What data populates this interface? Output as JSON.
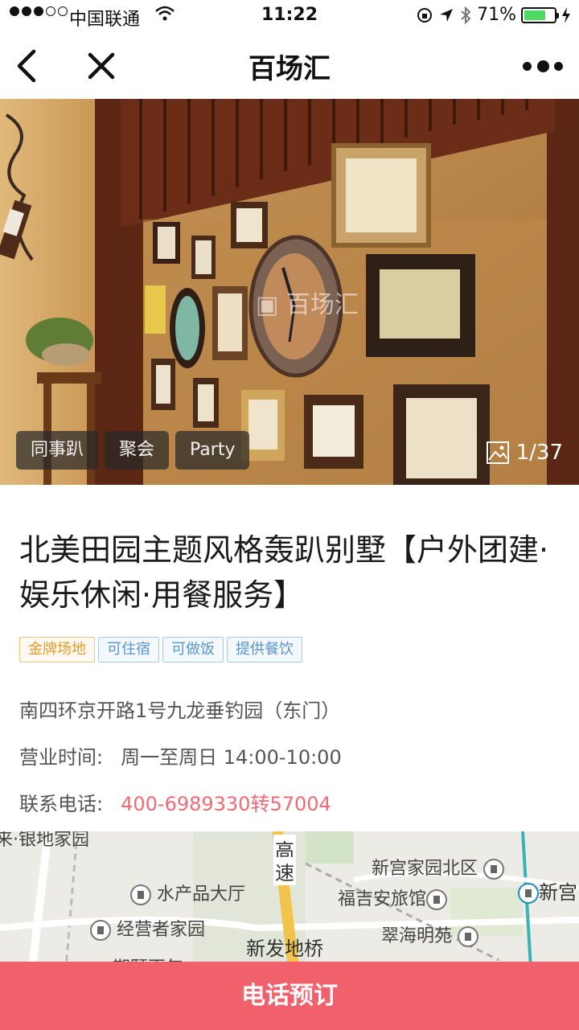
{
  "status_bar": {
    "carrier": "中国联通",
    "time": "11:22",
    "battery": "71%",
    "battery_level": 0.71,
    "icons": [
      "signal-dots-icon",
      "wifi-icon",
      "rotation-lock-icon",
      "location-arrow-icon",
      "bluetooth-icon",
      "battery-icon",
      "charging-icon"
    ]
  },
  "nav": {
    "title": "百场汇",
    "icons": [
      "back-chevron-icon",
      "close-x-icon",
      "more-dots-icon"
    ]
  },
  "hero": {
    "tags": [
      "同事趴",
      "聚会",
      "Party"
    ],
    "counter": "1/37",
    "watermark": "百场汇",
    "colors": {
      "wall": "#b88443",
      "frame_dark": "#4a2a18"
    }
  },
  "venue": {
    "title": "北美田园主题风格轰趴别墅【户外团建·娱乐休闲·用餐服务】",
    "features": [
      {
        "label": "金牌场地",
        "style": "gold"
      },
      {
        "label": "可住宿",
        "style": "blue"
      },
      {
        "label": "可做饭",
        "style": "blue"
      },
      {
        "label": "提供餐饮",
        "style": "blue"
      }
    ],
    "address": "南四环京开路1号九龙垂钓园（东门）",
    "hours_label": "营业时间:",
    "hours_value": "周一至周日 14:00-10:00",
    "phone_label": "联系电话:",
    "phone_value": "400-6989330转57004"
  },
  "map": {
    "labels": {
      "top_cut": "来·银地家园",
      "highway_a": "高",
      "highway_b": "速",
      "xgj": "新宫家园北区",
      "xingong": "新宫",
      "scp": "水产品大厅",
      "fja": "福吉安旅馆",
      "jyz": "经营者家园",
      "xfd": "新发地桥",
      "chy": "翠海明苑",
      "bottom_cut": "期颐百年"
    }
  },
  "cta": {
    "label": "电话预订"
  }
}
